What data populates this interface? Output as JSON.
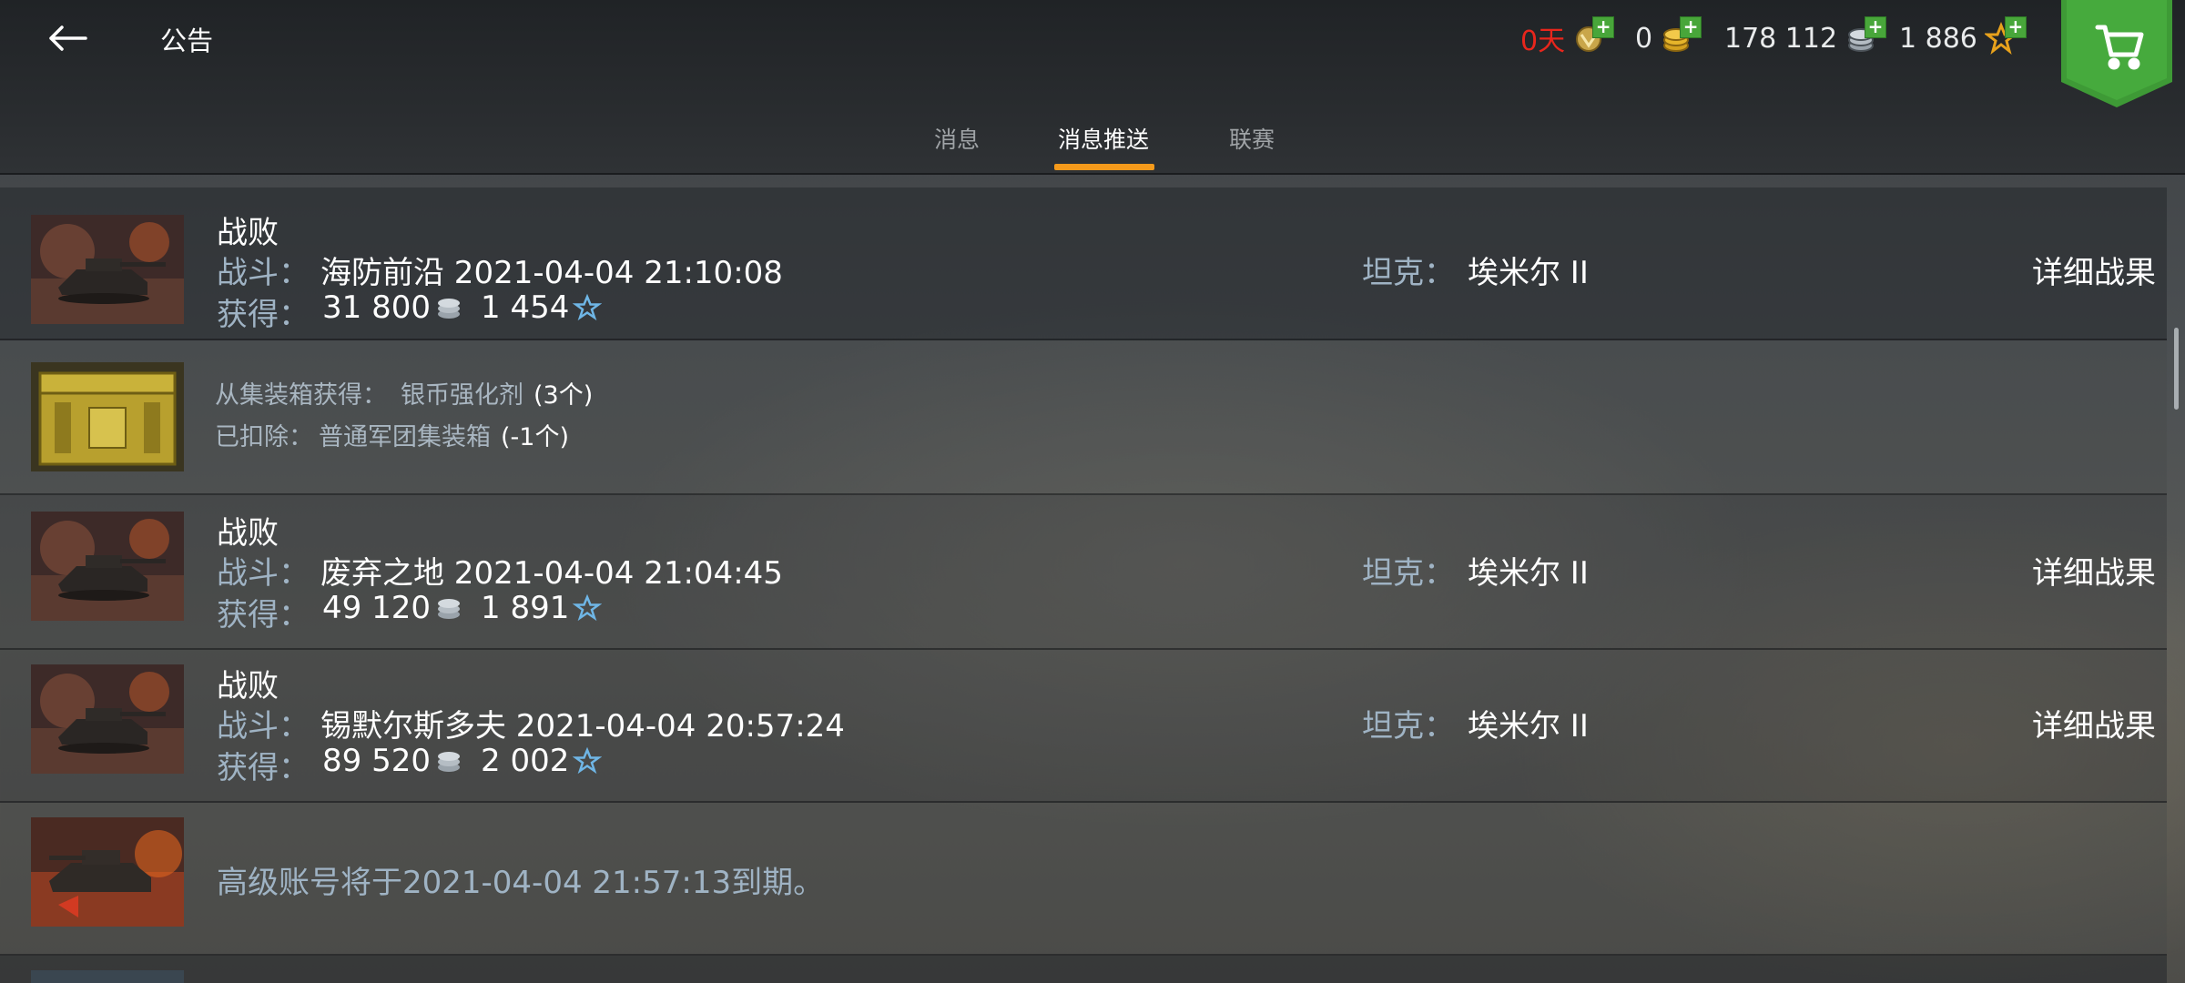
{
  "header": {
    "title": "公告",
    "premium_days": "0天",
    "gold": "0",
    "credits": "178 112",
    "free_xp": "1 886"
  },
  "tabs": [
    {
      "label": "消息"
    },
    {
      "label": "消息推送"
    },
    {
      "label": "联赛"
    }
  ],
  "active_tab": 1,
  "labels": {
    "battle": "战斗：",
    "earned": "获得：",
    "tank": "坦克：",
    "details": "详细战果",
    "defeat": "战败"
  },
  "messages": [
    {
      "type": "battle",
      "result": "战败",
      "map_time": "海防前沿 2021-04-04 21:10:08",
      "credits": "31 800",
      "xp": "1 454",
      "tank": "埃米尔 II"
    },
    {
      "type": "container",
      "obtained_label": "从集装箱获得：",
      "obtained_item": "银币强化剂",
      "obtained_qty": "(3个)",
      "removed_label": "已扣除：",
      "removed_item": "普通军团集装箱",
      "removed_qty": "(-1个)"
    },
    {
      "type": "battle",
      "result": "战败",
      "map_time": "废弃之地 2021-04-04 21:04:45",
      "credits": "49 120",
      "xp": "1 891",
      "tank": "埃米尔 II"
    },
    {
      "type": "battle",
      "result": "战败",
      "map_time": "锡默尔斯多夫 2021-04-04 20:57:24",
      "credits": "89 520",
      "xp": "2 002",
      "tank": "埃米尔 II"
    },
    {
      "type": "notice",
      "text": "高级账号将于2021-04-04 21:57:13到期。"
    }
  ],
  "colors": {
    "accent": "#f59a1b",
    "premium_red": "#e8261c",
    "label_blue": "#9fb3c4",
    "shop_green": "#3e9a36"
  }
}
